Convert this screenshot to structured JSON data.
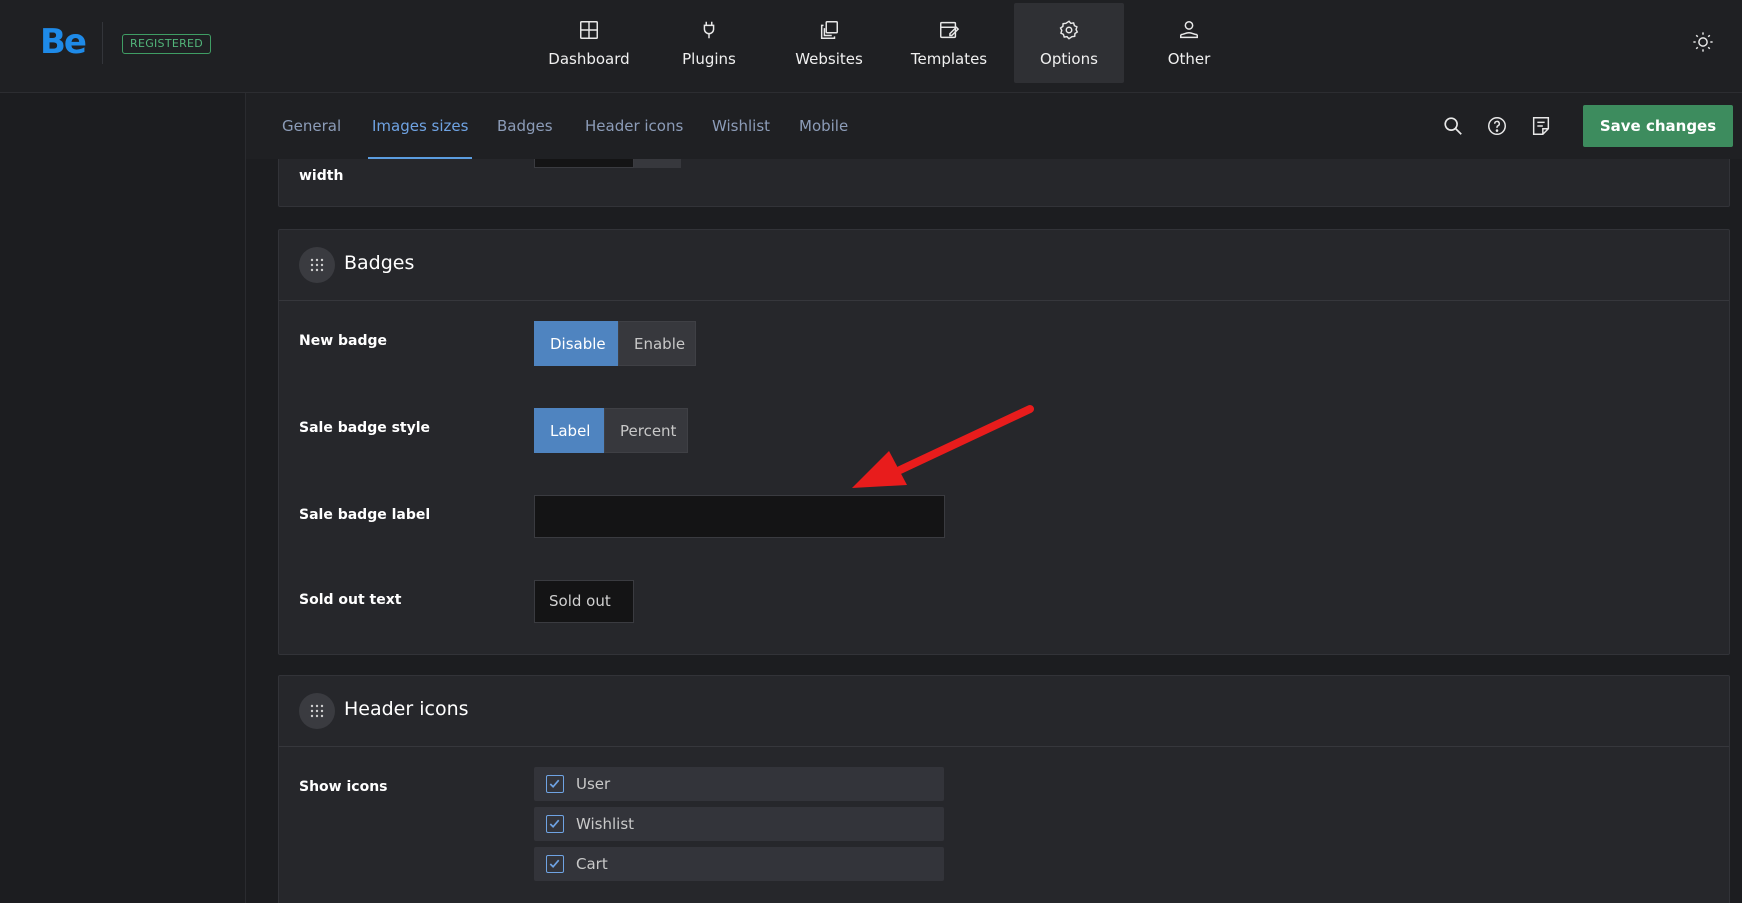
{
  "app": {
    "logo": "Be",
    "registered_badge": "REGISTERED"
  },
  "nav": [
    {
      "label": "Dashboard",
      "icon": "dashboard-icon",
      "active": false
    },
    {
      "label": "Plugins",
      "icon": "plug-icon",
      "active": false
    },
    {
      "label": "Websites",
      "icon": "websites-icon",
      "active": false
    },
    {
      "label": "Templates",
      "icon": "templates-icon",
      "active": false
    },
    {
      "label": "Options",
      "icon": "gear-icon",
      "active": true
    },
    {
      "label": "Other",
      "icon": "other-icon",
      "active": false
    }
  ],
  "tabs": [
    {
      "label": "General",
      "active": false
    },
    {
      "label": "Images sizes",
      "active": true
    },
    {
      "label": "Badges",
      "active": false
    },
    {
      "label": "Header icons",
      "active": false
    },
    {
      "label": "Wishlist",
      "active": false
    },
    {
      "label": "Mobile",
      "active": false
    }
  ],
  "toolbar": {
    "save_label": "Save changes"
  },
  "images_section": {
    "partial_label": "width"
  },
  "badges": {
    "title": "Badges",
    "new_badge": {
      "label": "New badge",
      "options": [
        "Disable",
        "Enable"
      ],
      "selected": "Disable"
    },
    "sale_badge_style": {
      "label": "Sale badge style",
      "options": [
        "Label",
        "Percent"
      ],
      "selected": "Label"
    },
    "sale_badge_label": {
      "label": "Sale badge label",
      "value": ""
    },
    "sold_out_text": {
      "label": "Sold out text",
      "value": "Sold out"
    }
  },
  "header_icons": {
    "title": "Header icons",
    "show_icons": {
      "label": "Show icons",
      "items": [
        {
          "label": "User",
          "checked": true
        },
        {
          "label": "Wishlist",
          "checked": true
        },
        {
          "label": "Cart",
          "checked": true
        }
      ]
    }
  },
  "colors": {
    "accent_blue": "#5b9de0",
    "save_green": "#3d8c5e",
    "annotation_red": "#e81c1c"
  }
}
